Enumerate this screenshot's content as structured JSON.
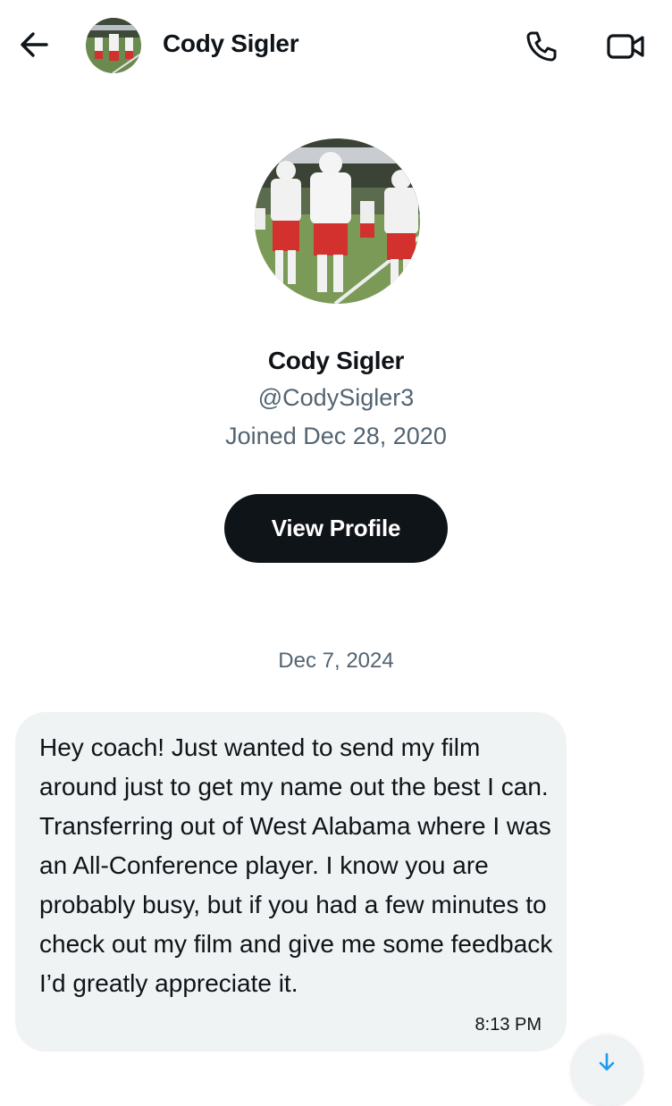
{
  "header": {
    "name": "Cody Sigler",
    "back_icon": "arrow-left-icon",
    "call_icon": "phone-icon",
    "video_icon": "video-camera-icon"
  },
  "profile": {
    "name": "Cody Sigler",
    "handle": "@CodySigler3",
    "joined": "Joined Dec 28, 2020",
    "view_profile_label": "View Profile"
  },
  "conversation": {
    "date_separator": "Dec 7, 2024",
    "messages": [
      {
        "text": "Hey coach! Just wanted to send my film around just to get my name out the best I can. Transferring out of West Alabama where I was an All-Conference player. I know you are probably busy, but if you had a few minutes to check out my film and give me some feedback I’d greatly appreciate it.",
        "time": "8:13 PM"
      }
    ]
  },
  "colors": {
    "primary_text": "#0f1419",
    "secondary_text": "#536471",
    "bubble_bg": "#eff3f4",
    "button_bg": "#0f1419",
    "accent": "#1d9bf0"
  }
}
